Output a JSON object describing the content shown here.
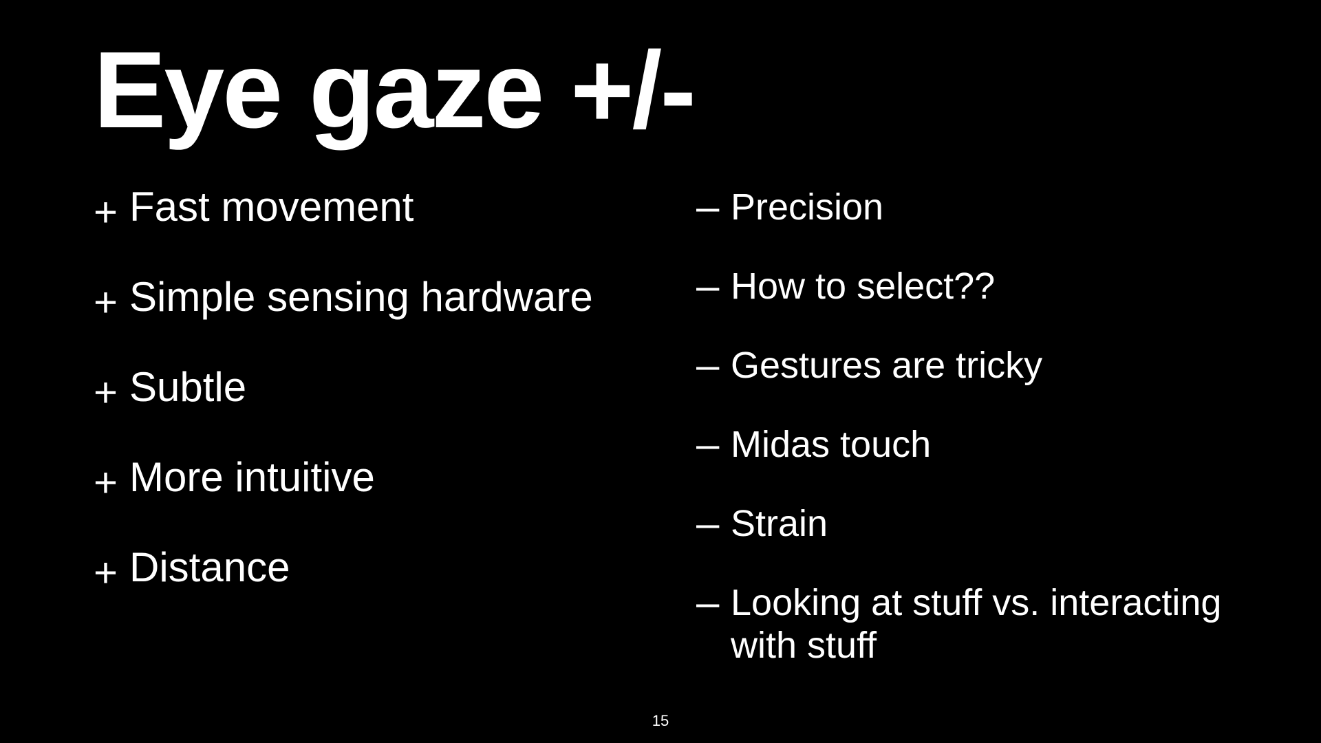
{
  "slide": {
    "title": "Eye gaze +/-",
    "pros_bullet": "+",
    "cons_bullet": "–",
    "pros": [
      "Fast movement",
      "Simple sensing hardware",
      "Subtle",
      "More intuitive",
      "Distance"
    ],
    "cons": [
      "Precision",
      "How to select??",
      "Gestures are tricky",
      "Midas touch",
      "Strain",
      "Looking at stuff vs. interacting with stuff"
    ],
    "page_number": "15"
  }
}
